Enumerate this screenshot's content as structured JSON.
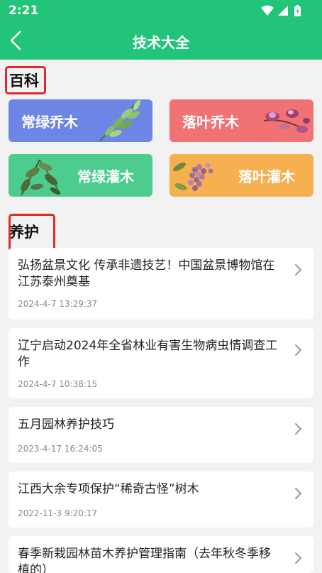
{
  "status": {
    "time": "2:21"
  },
  "nav": {
    "title": "技术大全"
  },
  "sections": {
    "baike": "百科",
    "yanghu": "养护"
  },
  "categories": [
    {
      "label": "常绿乔木",
      "color": "#6d86e6"
    },
    {
      "label": "落叶乔木",
      "color": "#f07272"
    },
    {
      "label": "常绿灌木",
      "color": "#4ccd8f"
    },
    {
      "label": "落叶灌木",
      "color": "#f6b04f"
    }
  ],
  "articles": [
    {
      "title": "弘扬盆景文化 传承非遗技艺！中国盆景博物馆在江苏泰州奠基",
      "time": "2024-4-7 13:29:37"
    },
    {
      "title": "辽宁启动2024年全省林业有害生物病虫情调查工作",
      "time": "2024-4-7 10:38:15"
    },
    {
      "title": "五月园林养护技巧",
      "time": "2023-4-17 16:24:05"
    },
    {
      "title": "江西大余专项保护“稀奇古怪”树木",
      "time": "2022-11-3 9:20:17"
    },
    {
      "title": "春季新栽园林苗木养护管理指南（去年秋冬季移植的）",
      "time": ""
    }
  ]
}
